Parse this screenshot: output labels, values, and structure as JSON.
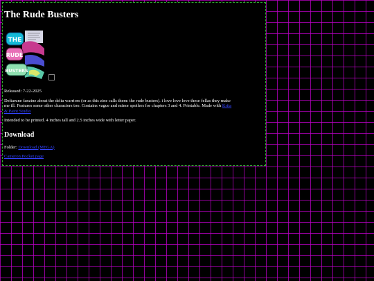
{
  "page": {
    "title": "The Rude Busters",
    "cover_art_text": [
      "THE",
      "RUDE",
      "BUSTERS"
    ],
    "released": "Released: 7-22-2025",
    "description": "Deltarune fanzine about the delta warriors (or as this zine calls them: the rude busters). i love love love these fellas they make me ill. Features some other characters too. Contains vague and minor spoilers for chapters 3 and 4. Printable. Made with",
    "made_with_link": "Krita & Paint Studio",
    "print_note": "Intended to be printed. 4 inches tall and 2.5 inches wide with letter paper.",
    "download_heading": "Download",
    "folder_label": "Folder: ",
    "folder_link": "Download (MEGA)",
    "second_link": "Cameron Pocket page"
  },
  "colors": {
    "background": "#000000",
    "grid": "#be00c8",
    "panel_border": "#2fa82f",
    "link": "#3344ff"
  }
}
